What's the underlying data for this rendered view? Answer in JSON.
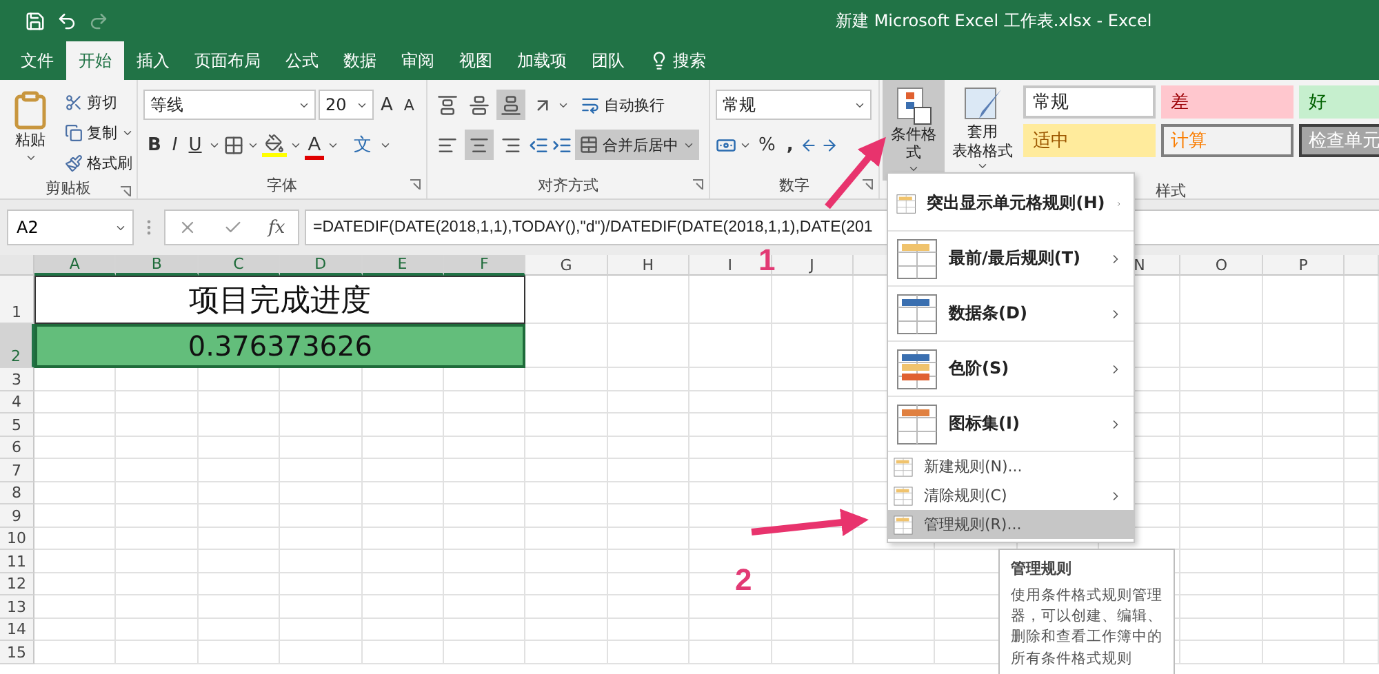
{
  "title_bar": {
    "title": "新建 Microsoft Excel 工作表.xlsx  -  Excel"
  },
  "tabs": [
    {
      "label": "文件",
      "selected": false,
      "kind": "tab"
    },
    {
      "label": "开始",
      "selected": true,
      "kind": "tab"
    },
    {
      "label": "插入",
      "selected": false,
      "kind": "tab"
    },
    {
      "label": "页面布局",
      "selected": false,
      "kind": "tab"
    },
    {
      "label": "公式",
      "selected": false,
      "kind": "tab"
    },
    {
      "label": "数据",
      "selected": false,
      "kind": "tab"
    },
    {
      "label": "审阅",
      "selected": false,
      "kind": "tab"
    },
    {
      "label": "视图",
      "selected": false,
      "kind": "tab"
    },
    {
      "label": "加载项",
      "selected": false,
      "kind": "tab"
    },
    {
      "label": "团队",
      "selected": false,
      "kind": "tab"
    },
    {
      "label": "搜索",
      "selected": false,
      "kind": "search"
    }
  ],
  "ribbon": {
    "clipboard": {
      "paste": "粘贴",
      "items": [
        "剪切",
        "复制",
        "格式刷"
      ],
      "label": "剪贴板"
    },
    "font": {
      "name": "等线",
      "size": "20",
      "grow": "A",
      "shrink": "A",
      "bold": "B",
      "italic": "I",
      "underline": "U",
      "color_letter": "A",
      "phonetic": "文",
      "label": "字体"
    },
    "alignment": {
      "vertical_align": [
        {
          "selected": false
        },
        {
          "selected": false
        },
        {
          "selected": true
        }
      ],
      "horizontal_align": [
        {
          "selected": false
        },
        {
          "selected": true
        },
        {
          "selected": false
        }
      ],
      "wrap": "自动换行",
      "merge": {
        "label": "合并后居中",
        "selected": true
      },
      "label": "对齐方式"
    },
    "number": {
      "format": "常规",
      "percent": "%",
      "comma": ",",
      "label": "数字"
    },
    "styles": {
      "conditional": {
        "label": "条件格式",
        "selected": true
      },
      "table_format": {
        "line_1": "套用",
        "line_2": "表格格式"
      },
      "gallery": [
        {
          "label": "常规",
          "kind": "normal"
        },
        {
          "label": "差",
          "kind": "bad"
        },
        {
          "label": "好",
          "kind": "good"
        },
        {
          "label": "适中",
          "kind": "neutral"
        },
        {
          "label": "计算",
          "kind": "calculation"
        },
        {
          "label": "检查单元",
          "kind": "check"
        }
      ],
      "label": "样式"
    }
  },
  "formula_bar": {
    "name_box": "A2",
    "fx": "fx",
    "formula": "=DATEDIF(DATE(2018,1,1),TODAY(),\"d\")/DATEDIF(DATE(2018,1,1),DATE(201"
  },
  "sheet": {
    "columns": [
      {
        "label": "A",
        "selected": true
      },
      {
        "label": "B",
        "selected": true
      },
      {
        "label": "C",
        "selected": true
      },
      {
        "label": "D",
        "selected": true
      },
      {
        "label": "E",
        "selected": true
      },
      {
        "label": "F",
        "selected": true
      },
      {
        "label": "G",
        "selected": false
      },
      {
        "label": "H",
        "selected": false
      },
      {
        "label": "I",
        "selected": false
      },
      {
        "label": "J",
        "selected": false
      }
    ],
    "columns_right": [
      {
        "label": "N",
        "selected": false
      },
      {
        "label": "O",
        "selected": false
      },
      {
        "label": "P",
        "selected": false
      }
    ],
    "rows": [
      {
        "number": "1",
        "selected": false,
        "merged": {
          "text": "项目完成进度",
          "kind": "plain"
        }
      },
      {
        "number": "2",
        "selected": true,
        "merged": {
          "text": "0.376373626",
          "kind": "highlight"
        }
      },
      {
        "number": "3",
        "selected": false
      },
      {
        "number": "4",
        "selected": false
      },
      {
        "number": "5",
        "selected": false
      },
      {
        "number": "6",
        "selected": false
      },
      {
        "number": "7",
        "selected": false
      },
      {
        "number": "8",
        "selected": false
      },
      {
        "number": "9",
        "selected": false
      },
      {
        "number": "10",
        "selected": false
      },
      {
        "number": "11",
        "selected": false
      },
      {
        "number": "12",
        "selected": false
      },
      {
        "number": "13",
        "selected": false
      },
      {
        "number": "14",
        "selected": false
      },
      {
        "number": "15",
        "selected": false
      }
    ]
  },
  "menu": {
    "items": [
      {
        "label": "突出显示单元格规则(H)",
        "kind": "large",
        "submenu": true,
        "selected": false
      },
      {
        "label": "最前/最后规则(T)",
        "kind": "large",
        "submenu": true,
        "selected": false
      },
      {
        "label": "数据条(D)",
        "kind": "large",
        "submenu": true,
        "selected": false
      },
      {
        "label": "色阶(S)",
        "kind": "large",
        "submenu": true,
        "selected": false
      },
      {
        "label": "图标集(I)",
        "kind": "large",
        "submenu": true,
        "selected": false
      },
      {
        "label": "新建规则(N)...",
        "kind": "small",
        "submenu": false,
        "selected": false
      },
      {
        "label": "清除规则(C)",
        "kind": "small",
        "submenu": true,
        "selected": false
      },
      {
        "label": "管理规则(R)...",
        "kind": "small",
        "submenu": false,
        "selected": true
      }
    ]
  },
  "tooltip": {
    "title": "管理规则",
    "body": "使用条件格式规则管理器，可以创建、编辑、删除和查看工作簿中的所有条件格式规则"
  },
  "annotations": [
    {
      "label": "1"
    },
    {
      "label": "2"
    }
  ]
}
